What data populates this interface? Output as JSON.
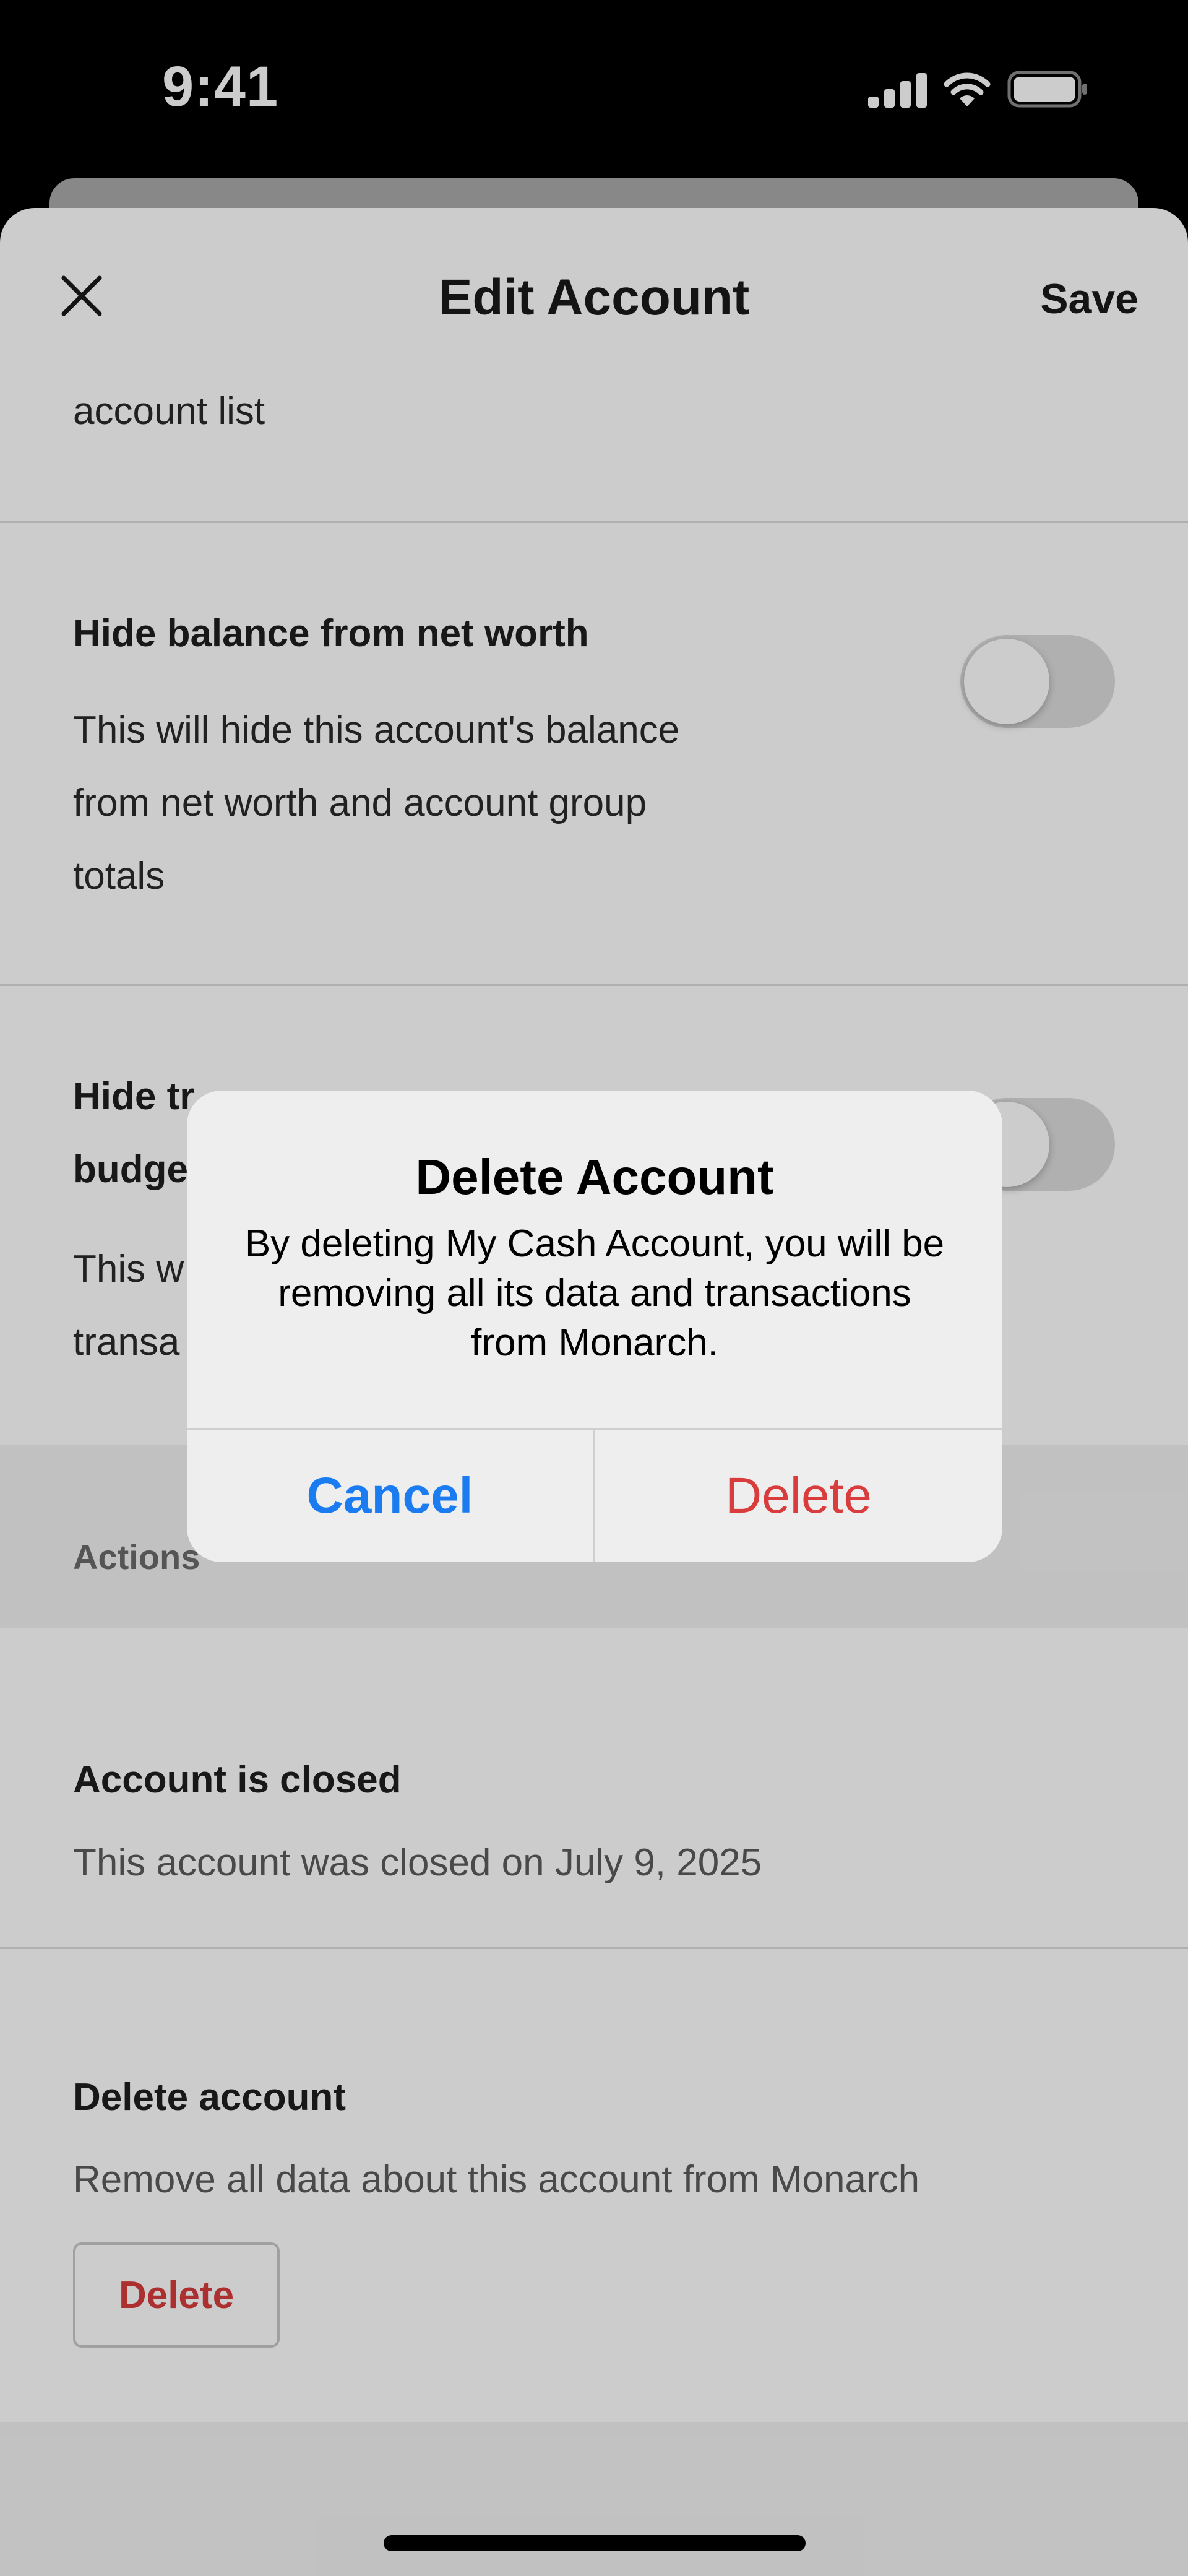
{
  "status_bar": {
    "time": "9:41"
  },
  "header": {
    "title": "Edit Account",
    "save_label": "Save",
    "close_icon": "close-icon"
  },
  "settings": {
    "partial_text": "account list",
    "hide_balance": {
      "title": "Hide balance from net worth",
      "desc_lines": [
        "This will hide this account's balance",
        "from net worth and account group",
        "totals"
      ],
      "enabled": false
    },
    "hide_transactions": {
      "title_visible_lines": [
        "Hide tr",
        "budge"
      ],
      "desc_visible_lines": [
        "This w",
        "transa"
      ],
      "enabled": false
    }
  },
  "actions": {
    "label": "Actions",
    "closed": {
      "title": "Account is closed",
      "desc": "This account was closed on July 9, 2025"
    },
    "delete_account": {
      "title": "Delete account",
      "desc": "Remove all data about this account from Monarch",
      "button_label": "Delete"
    }
  },
  "dialog": {
    "title": "Delete Account",
    "message": "By deleting My Cash Account, you will be removing all its data and transactions from Monarch.",
    "cancel_label": "Cancel",
    "delete_label": "Delete"
  },
  "colors": {
    "accent_blue": "#1a7cf0",
    "destructive_red": "#d93c3c",
    "toggle_off": "#dcdcdc"
  }
}
